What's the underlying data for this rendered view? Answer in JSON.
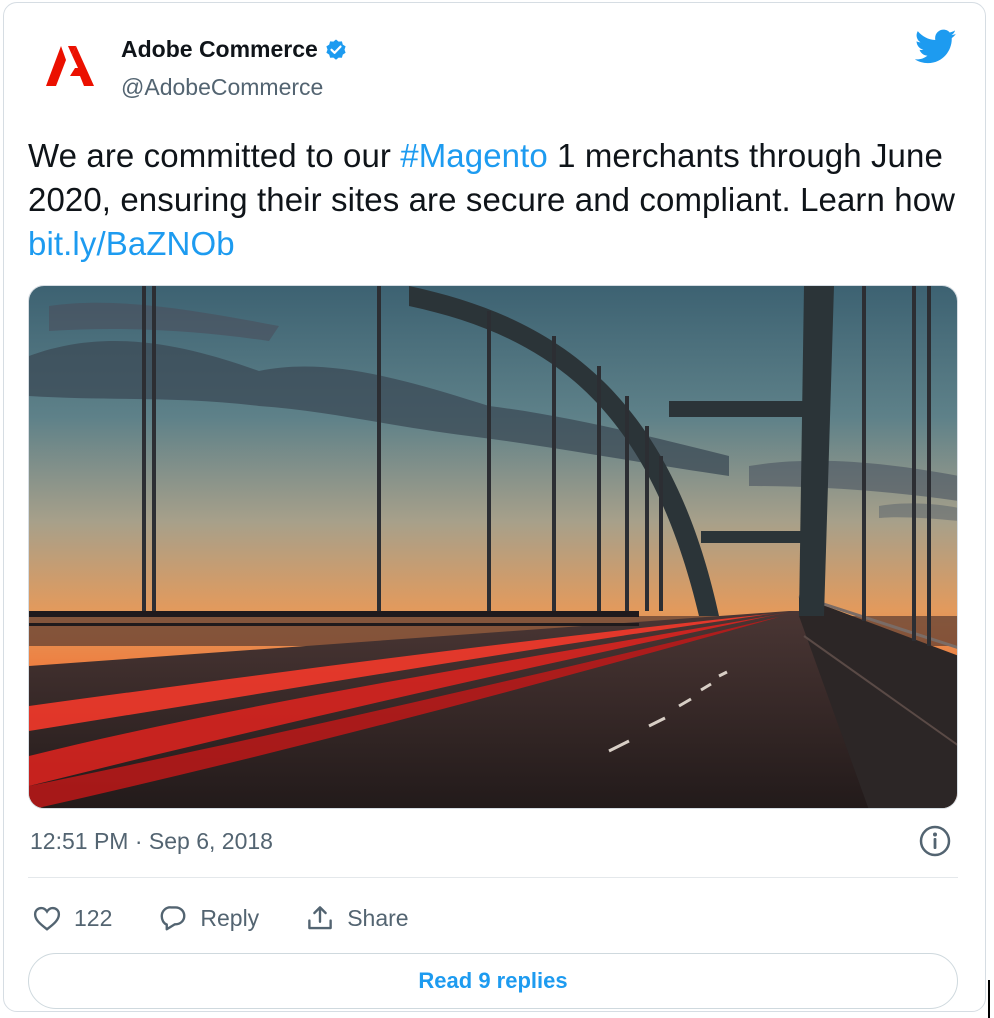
{
  "tweet": {
    "author": {
      "display_name": "Adobe Commerce",
      "handle": "@AdobeCommerce",
      "verified": true,
      "avatar_icon": "adobe-logo",
      "brand_color": "#eb1000"
    },
    "text": {
      "part1": "We are committed to our ",
      "hashtag": "#Magento",
      "part2": " 1 merchants through June 2020, ensuring their sites are secure and compliant. Learn how ",
      "link": "bit.ly/BaZNOb"
    },
    "media": {
      "icon": "bridge-photo"
    },
    "timestamp": "12:51 PM · Sep 6, 2018",
    "actions": {
      "likes_count": "122",
      "reply_label": "Reply",
      "share_label": "Share"
    },
    "read_replies_label": "Read 9 replies"
  },
  "colors": {
    "link": "#1d9bf0",
    "twitter_blue": "#1d9bf0",
    "secondary_text": "#536471"
  }
}
